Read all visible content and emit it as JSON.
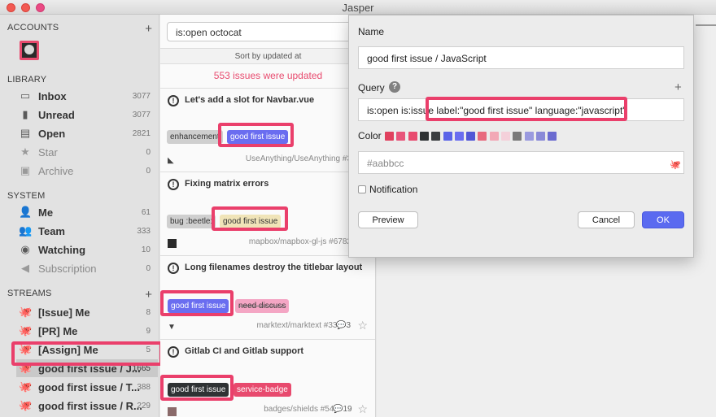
{
  "window": {
    "title": "Jasper"
  },
  "sidebar": {
    "accounts_title": "ACCOUNTS",
    "library_title": "LIBRARY",
    "system_title": "SYSTEM",
    "streams_title": "STREAMS",
    "library": [
      {
        "label": "Inbox",
        "count": "3077",
        "icon": "inbox-icon"
      },
      {
        "label": "Unread",
        "count": "3077",
        "icon": "book-icon"
      },
      {
        "label": "Open",
        "count": "2821",
        "icon": "document-icon"
      },
      {
        "label": "Star",
        "count": "0",
        "icon": "star-icon"
      },
      {
        "label": "Archive",
        "count": "0",
        "icon": "archive-icon"
      }
    ],
    "system": [
      {
        "label": "Me",
        "count": "61",
        "icon": "person-icon"
      },
      {
        "label": "Team",
        "count": "333",
        "icon": "team-icon"
      },
      {
        "label": "Watching",
        "count": "10",
        "icon": "eye-icon"
      },
      {
        "label": "Subscription",
        "count": "0",
        "icon": "megaphone-icon"
      }
    ],
    "streams": [
      {
        "label": "[Issue] Me",
        "count": "8",
        "icon": "octocat-icon"
      },
      {
        "label": "[PR] Me",
        "count": "9",
        "icon": "octocat-icon"
      },
      {
        "label": "[Assign] Me",
        "count": "5",
        "icon": "octocat-icon"
      },
      {
        "label": "good first issue / J...",
        "count": "1665",
        "icon": "octocat-icon"
      },
      {
        "label": "good first issue / T...",
        "count": "388",
        "icon": "octocat-icon"
      },
      {
        "label": "good first issue / R...",
        "count": "229",
        "icon": "octocat-icon"
      }
    ]
  },
  "list": {
    "search_value": "is:open octocat",
    "sort_label": "Sort by updated at",
    "updated_notice": "553 issues were updated",
    "issues": [
      {
        "title": "Let's add a slot for Navbar.vue",
        "labels": [
          "enhancement",
          "good first issue"
        ],
        "repo": "UseAnything/UseAnything #3",
        "comments": "",
        "icon": "vue-icon"
      },
      {
        "title": "Fixing matrix errors",
        "labels": [
          "bug :beetle:",
          "good first issue"
        ],
        "repo": "mapbox/mapbox-gl-js #6782",
        "comments": "",
        "icon": "mapbox-icon"
      },
      {
        "title": "Long filenames destroy the titlebar layout",
        "labels": [
          "good first issue",
          "need discuss"
        ],
        "repo": "marktext/marktext #339",
        "comments": "3",
        "icon": "marktext-icon"
      },
      {
        "title": "Gitlab CI and Gitlab support",
        "labels": [
          "good first issue",
          "service-badge"
        ],
        "repo": "badges/shields #541",
        "comments": "19",
        "icon": "shields-icon"
      }
    ]
  },
  "dialog": {
    "name_label": "Name",
    "name_value": "good first issue / JavaScript",
    "query_label": "Query",
    "query_value": "is:open is:issue label:\"good first issue\" language:\"javascript\"",
    "color_label": "Color",
    "color_value": "#aabbcc",
    "swatches": [
      "#e0405e",
      "#e8547a",
      "#e84a6e",
      "#2f3234",
      "#3a3d40",
      "#5a63e8",
      "#6a6df0",
      "#5257d6",
      "#e86a7e",
      "#f2a8b6",
      "#f4d0da",
      "#7a7a7a",
      "#9a9adf",
      "#8a8ad8",
      "#6b6bd0"
    ],
    "notification_label": "Notification",
    "preview_button": "Preview",
    "cancel_button": "Cancel",
    "ok_button": "OK"
  }
}
